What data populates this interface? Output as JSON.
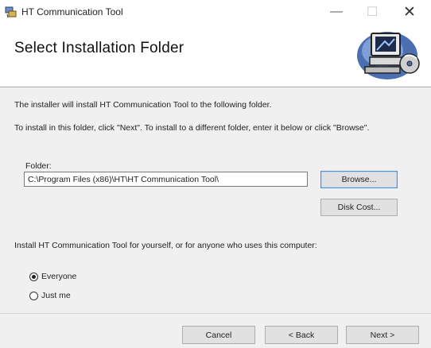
{
  "window": {
    "title": "HT Communication Tool",
    "controls": {
      "minimize": "—",
      "maximize": "☐",
      "close": "✕"
    }
  },
  "header": {
    "title": "Select Installation Folder",
    "art_icon": "computer-disk-icon"
  },
  "body": {
    "intro": "The installer will install HT Communication Tool to the following folder.",
    "instructions": "To install in this folder, click \"Next\". To install to a different folder, enter it below or click \"Browse\"."
  },
  "folder": {
    "label": "Folder:",
    "value": "C:\\Program Files (x86)\\HT\\HT Communication Tool\\"
  },
  "buttons": {
    "browse": "Browse...",
    "disk_cost": "Disk Cost...",
    "cancel": "Cancel",
    "back": "< Back",
    "next": "Next >"
  },
  "install_for": {
    "prompt": "Install HT Communication Tool for yourself, or for anyone who uses this computer:",
    "options": [
      {
        "label": "Everyone",
        "selected": true
      },
      {
        "label": "Just me",
        "selected": false
      }
    ]
  }
}
